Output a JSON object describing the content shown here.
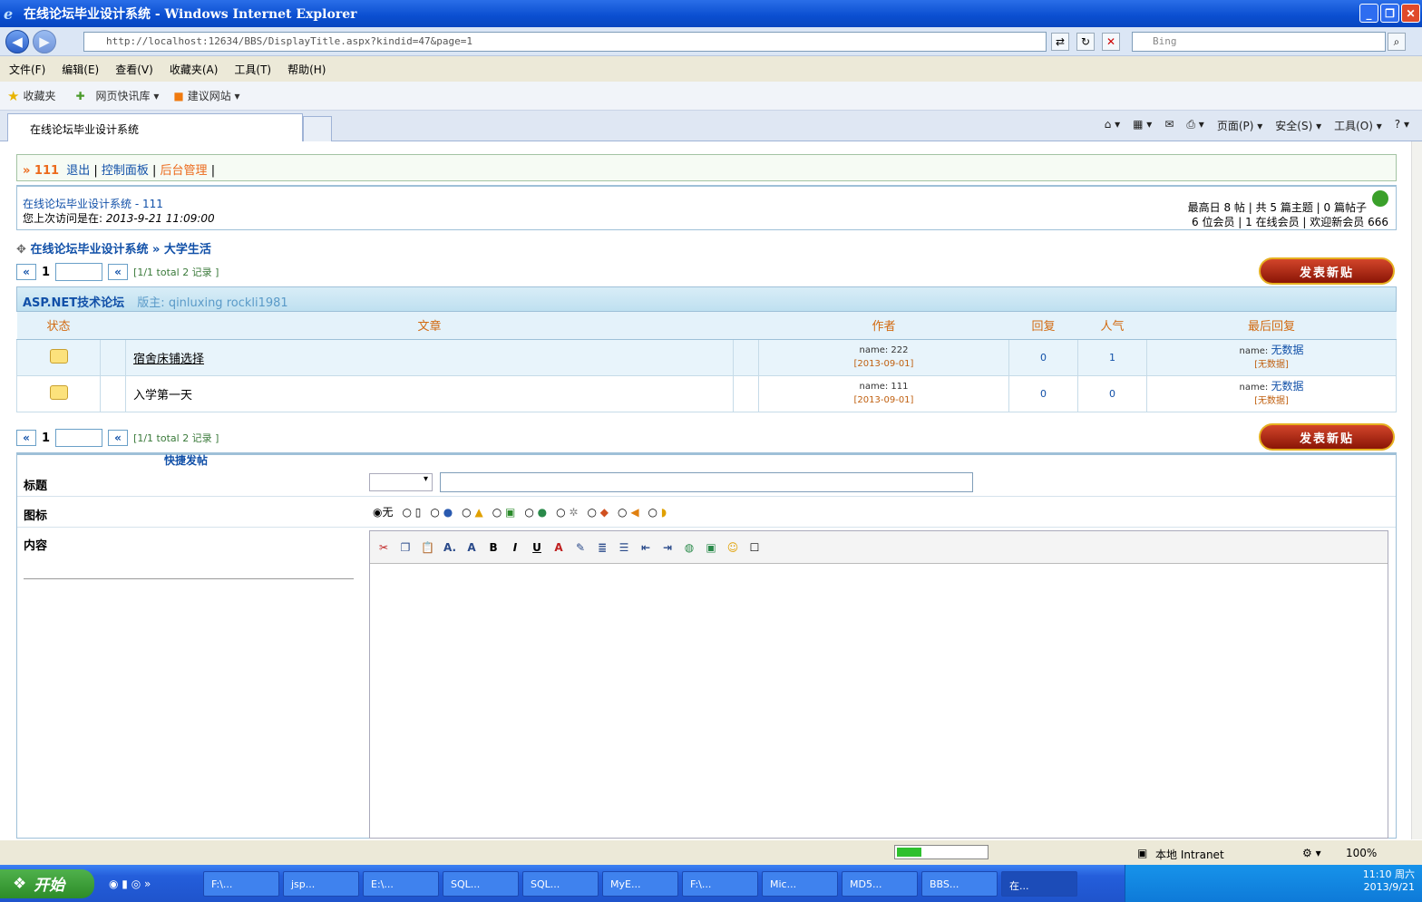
{
  "window": {
    "title": "在线论坛毕业设计系统 - Windows Internet Explorer"
  },
  "address": {
    "url": "http://localhost:12634/BBS/DisplayTitle.aspx?kindid=47&page=1",
    "search_placeholder": "Bing"
  },
  "menu": [
    "文件(F)",
    "编辑(E)",
    "查看(V)",
    "收藏夹(A)",
    "工具(T)",
    "帮助(H)"
  ],
  "favbar": {
    "favorites": "收藏夹",
    "item1": "网页快讯库 ▾",
    "item2": "建议网站 ▾"
  },
  "tab": {
    "title": "在线论坛毕业设计系统"
  },
  "cmdbar": [
    "页面(P) ▾",
    "安全(S) ▾",
    "工具(O) ▾"
  ],
  "userbar": {
    "user": "» 111",
    "logout": "退出",
    "panel": "控制面板",
    "admin": "后台管理"
  },
  "info": {
    "site": "在线论坛毕业设计系统 - 111",
    "last_visit_label": "您上次访问是在:",
    "last_visit": "2013-9-21 11:09:00",
    "stats1": "最高日 8 帖 | 共 5 篇主题 | 0 篇帖子",
    "stats2": "6 位会员 | 1 在线会员 | 欢迎新会员 666"
  },
  "crumb": {
    "site": "在线论坛毕业设计系统",
    "sep": "»",
    "section": "大学生活"
  },
  "pager": {
    "first": "«",
    "page": "1",
    "prev": "«",
    "info": "[1/1 total 2 记录 ]"
  },
  "post_button": "发表新贴",
  "forum": {
    "name": "ASP.NET技术论坛",
    "mods_label": "版主:",
    "mods": "qinluxing rockli1981"
  },
  "columns": {
    "status": "状态",
    "article": "文章",
    "author": "作者",
    "replies": "回复",
    "views": "人气",
    "last": "最后回复"
  },
  "topics": [
    {
      "title": "宿舍床铺选择",
      "author": "name: 222",
      "date": "[2013-09-01]",
      "replies": "0",
      "views": "1",
      "last_label": "name:",
      "last_name": "无数据",
      "last_date": "[无数据]"
    },
    {
      "title": "入学第一天",
      "author": "name: 111",
      "date": "[2013-09-01]",
      "replies": "0",
      "views": "0",
      "last_label": "name:",
      "last_name": "无数据",
      "last_date": "[无数据]"
    }
  ],
  "quick": {
    "header": "快捷发帖",
    "title_label": "标题",
    "icon_label": "图标",
    "content_label": "内容",
    "icon_none": "无"
  },
  "status": {
    "zone": "本地 Intranet",
    "zoom": "100%"
  },
  "taskbar": {
    "start": "开始",
    "items": [
      "F:\\...",
      "jsp...",
      "E:\\...",
      "SQL...",
      "SQL...",
      "MyE...",
      "F:\\...",
      "Mic...",
      "MD5...",
      "BBS...",
      "在..."
    ],
    "time": "11:10 周六",
    "date": "2013/9/21"
  }
}
